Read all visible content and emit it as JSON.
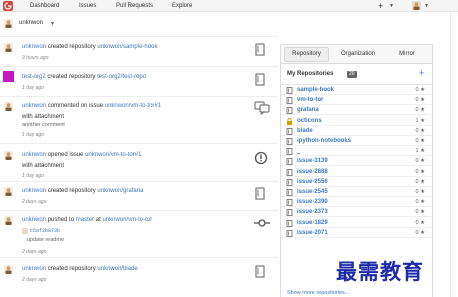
{
  "nav": {
    "items": [
      "Dashboard",
      "Issues",
      "Pull Requests",
      "Explore"
    ],
    "plus_label": "+"
  },
  "user_switch": {
    "name": "unknwon"
  },
  "feed": [
    {
      "actor": "unknwon",
      "action": "created repository",
      "target": "unknwon/sample-hook",
      "time": "9 hours ago",
      "icon": "repo-icon"
    },
    {
      "actor": "test-org2",
      "action": "created repository",
      "target": "test-org2/test-repo",
      "time": "1 day ago",
      "icon": "repo-icon"
    },
    {
      "actor": "unknwon",
      "action": "commented on issue",
      "target": "unknwon/vm-to-tor#1",
      "time": "1 day ago",
      "sub": "with attachment",
      "sub2": "another comment",
      "icon": "comment-icon"
    },
    {
      "actor": "unknwon",
      "action": "opened issue",
      "target": "unknwon/vm-to-tor#1",
      "time": "1 day ago",
      "sub": "with attachment",
      "icon": "issue-opened-icon"
    },
    {
      "actor": "unknwon",
      "action": "created repository",
      "target": "unknwon/grafana",
      "time": "2 days ago",
      "icon": "repo-icon"
    },
    {
      "actor": "unknwon",
      "action": "pushed to",
      "branch": "master",
      "at": "at",
      "target": "unknwon/vm-to-tor",
      "commit_sha": "c5af2b873b",
      "commit_msg": "update readme",
      "time": "2 days ago",
      "icon": "commit-icon"
    },
    {
      "actor": "unknwon",
      "action": "created repository",
      "target": "unknwon/blade",
      "time": "2 days ago",
      "icon": "repo-icon"
    }
  ],
  "panel": {
    "tabs": [
      "Repository",
      "Organization",
      "Mirror"
    ],
    "title": "My Repositories",
    "count": "20",
    "add_label": "+",
    "repos": [
      {
        "name": "sample-hook",
        "stars": "0",
        "icon": "repo-icon"
      },
      {
        "name": "vm-to-tor",
        "stars": "0",
        "icon": "repo-icon"
      },
      {
        "name": "grafana",
        "stars": "0",
        "icon": "repo-icon"
      },
      {
        "name": "octicons",
        "stars": "1",
        "icon": "lock-icon"
      },
      {
        "name": "blade",
        "stars": "0",
        "icon": "repo-icon"
      },
      {
        "name": "ipython-notebooks",
        "stars": "0",
        "icon": "repo-icon"
      },
      {
        "name": "_",
        "stars": "1",
        "icon": "repo-icon"
      },
      {
        "name": "issue-3139",
        "stars": "0",
        "icon": "repo-icon"
      },
      {
        "name": "issue-2888",
        "stars": "0",
        "icon": "repo-icon"
      },
      {
        "name": "issue-2556",
        "stars": "0",
        "icon": "repo-icon"
      },
      {
        "name": "issue-2545",
        "stars": "0",
        "icon": "repo-icon"
      },
      {
        "name": "issue-2390",
        "stars": "0",
        "icon": "repo-icon"
      },
      {
        "name": "issue-2373",
        "stars": "0",
        "icon": "repo-icon"
      },
      {
        "name": "issue-1829",
        "stars": "0",
        "icon": "repo-icon"
      },
      {
        "name": "issue-2071",
        "stars": "0",
        "icon": "repo-icon"
      }
    ],
    "show_more": "Show more repositories..."
  },
  "watermark": "最需教育"
}
